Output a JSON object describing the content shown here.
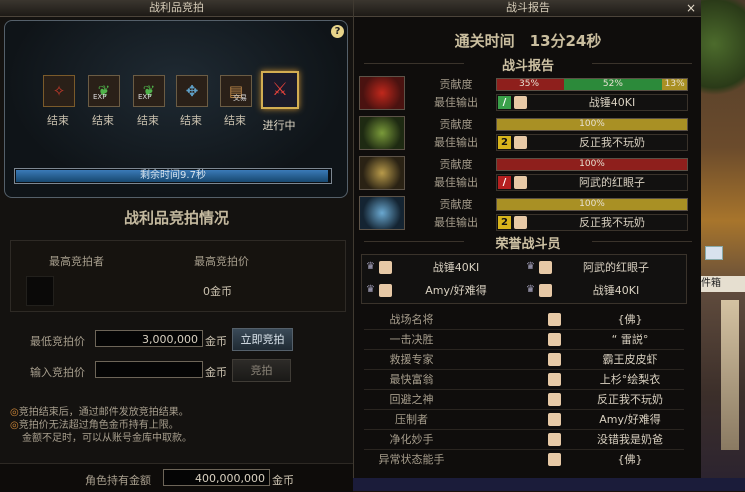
{
  "left": {
    "title": "战利品竞拍",
    "help_label": "?",
    "items": [
      {
        "label": "结束",
        "icon": "red-scroll-icon",
        "tag": ""
      },
      {
        "label": "结束",
        "icon": "exp-orb-icon",
        "tag": "EXP"
      },
      {
        "label": "结束",
        "icon": "exp-orb-icon",
        "tag": "EXP"
      },
      {
        "label": "结束",
        "icon": "blue-armor-icon",
        "tag": ""
      },
      {
        "label": "结束",
        "icon": "trade-book-icon",
        "tag": "交易"
      },
      {
        "label": "进行中",
        "icon": "crimson-weapon-icon",
        "tag": ""
      }
    ],
    "progress_text": "剩余时间9.7秒",
    "progress_fraction": 0.995,
    "status_heading": "战利品竞拍情况",
    "col_highest_bidder": "最高竞拍者",
    "col_highest_price": "最高竞拍价",
    "current_price": "0金币",
    "min_bid_label": "最低竞拍价",
    "min_bid_value": "3,000,000",
    "gold_unit": "金币",
    "instant_bid_label": "立即竞拍",
    "input_bid_label": "输入竞拍价",
    "input_bid_value": "",
    "bid_label": "竞拍",
    "notes": [
      "竞拍结束后，通过邮件发放竞拍结果。",
      "竞拍价无法超过角色金币持有上限。",
      "金额不足时，可以从账号金库中取款。"
    ],
    "held_gold_label": "角色持有金额",
    "held_gold_value": "400,000,000"
  },
  "right": {
    "title": "战斗报告",
    "close": "×",
    "clear_time": "通关时间　13分24秒",
    "report_heading": "战斗报告",
    "contribution_label": "贡献度",
    "best_output_label": "最佳输出",
    "rows": [
      {
        "portrait": "red-flame-mask",
        "segments": [
          {
            "value": 0.35,
            "color": "#8e1f1c",
            "text": "35%"
          },
          {
            "value": 0.52,
            "color": "#2c8a3a",
            "text": "52%"
          },
          {
            "value": 0.13,
            "color": "#a99024",
            "text": "13%"
          }
        ],
        "job": "/",
        "job_color": "#3aa04a",
        "best": "战锤40KI"
      },
      {
        "portrait": "green-insect-mask",
        "segments": [
          {
            "value": 1.0,
            "color": "#a99024",
            "text": "100%"
          }
        ],
        "job": "2",
        "job_color": "#d7b41c",
        "best": "反正我不玩奶"
      },
      {
        "portrait": "gold-beast-mask",
        "segments": [
          {
            "value": 1.0,
            "color": "#8e1f1c",
            "text": "100%"
          }
        ],
        "job": "/",
        "job_color": "#b52020",
        "best": "阿武的红眼子"
      },
      {
        "portrait": "blue-frost-mask",
        "segments": [
          {
            "value": 1.0,
            "color": "#a99024",
            "text": "100%"
          }
        ],
        "job": "2",
        "job_color": "#d7b41c",
        "best": "反正我不玩奶"
      }
    ],
    "honor_heading": "荣誉战斗员",
    "honor": [
      "战锤40KI",
      "阿武的红眼子",
      "Amy/好难得",
      "战锤40KI"
    ],
    "awards": [
      {
        "name": "战场名将",
        "who": "{佛}"
      },
      {
        "name": "一击决胜",
        "who": "“ 雷説°"
      },
      {
        "name": "救援专家",
        "who": "霸王皮皮虾"
      },
      {
        "name": "最快富翁",
        "who": "上杉°绘梨衣"
      },
      {
        "name": "回避之神",
        "who": "反正我不玩奶"
      },
      {
        "name": "压制者",
        "who": "Amy/好难得"
      },
      {
        "name": "净化妙手",
        "who": "没错我是奶爸"
      },
      {
        "name": "异常状态能手",
        "who": "{佛}"
      }
    ]
  },
  "scene": {
    "sign_text": "件箱"
  }
}
